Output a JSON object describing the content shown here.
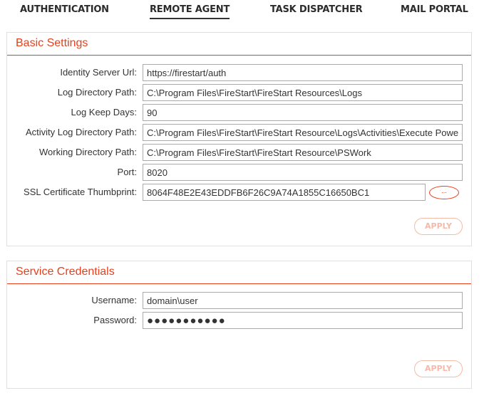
{
  "tabs": [
    {
      "label": "AUTHENTICATION",
      "active": false
    },
    {
      "label": "REMOTE AGENT",
      "active": true
    },
    {
      "label": "TASK DISPATCHER",
      "active": false
    },
    {
      "label": "MAIL PORTAL",
      "active": false
    }
  ],
  "basic_settings": {
    "title": "Basic Settings",
    "fields": [
      {
        "label": "Identity Server Url:",
        "value": "https://firestart/auth"
      },
      {
        "label": "Log Directory Path:",
        "value": "C:\\Program Files\\FireStart\\FireStart Resources\\Logs"
      },
      {
        "label": "Log Keep Days:",
        "value": "90"
      },
      {
        "label": "Activity Log Directory Path:",
        "value": "C:\\Program Files\\FireStart\\FireStart Resource\\Logs\\Activities\\Execute Power"
      },
      {
        "label": "Working Directory Path:",
        "value": "C:\\Program Files\\FireStart\\FireStart Resource\\PSWork"
      },
      {
        "label": "Port:",
        "value": "8020"
      },
      {
        "label": "SSL Certificate Thumbprint:",
        "value": "8064F48E2E43EDDFB6F26C9A74A1855C16650BC1"
      }
    ],
    "browse_label": "...",
    "apply_label": "APPLY"
  },
  "service_credentials": {
    "title": "Service Credentials",
    "username_label": "Username:",
    "username_value": "domain\\user",
    "password_label": "Password:",
    "password_value": "●●●●●●●●●●●",
    "apply_label": "APPLY"
  },
  "colors": {
    "accent": "#e8401c",
    "apply_disabled": "#f7b9a8",
    "panel_border": "#e0e0e0",
    "input_border": "#aaaaaa"
  }
}
